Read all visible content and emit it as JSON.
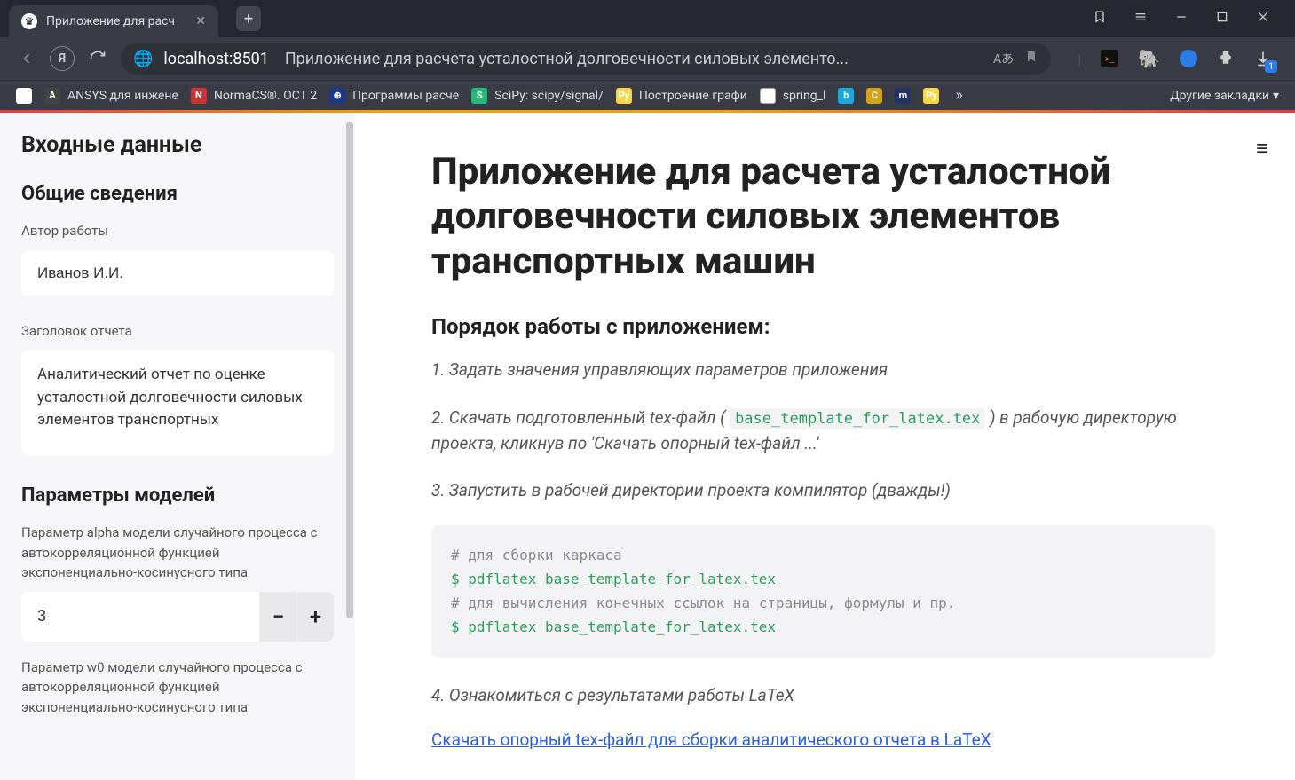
{
  "browser": {
    "tab_title": "Приложение для расч",
    "url_host": "localhost:8501",
    "page_title_truncated": "Приложение для расчета усталостной долговечности силовых элементо...",
    "bookmarks": [
      {
        "label": "ANSYS для инжене"
      },
      {
        "label": "NormaCS®. ОСТ 2"
      },
      {
        "label": "Программы расче"
      },
      {
        "label": "SciPy: scipy/signal/"
      },
      {
        "label": "Построение графи"
      },
      {
        "label": "spring_l"
      }
    ],
    "other_bookmarks_label": "Другие закладки"
  },
  "sidebar": {
    "title": "Входные данные",
    "section_general": "Общие сведения",
    "author_label": "Автор работы",
    "author_value": "Иванов И.И.",
    "report_title_label": "Заголовок отчета",
    "report_title_value": "Аналитический отчет по оценке усталостной долговечности силовых элементов транспортных",
    "section_models": "Параметры моделей",
    "alpha_label": "Параметр alpha модели случайного процесса с автокорреляционной функцией экспоненциально-косинусного типа",
    "alpha_value": "3",
    "w0_label": "Параметр w0 модели случайного процесса с автокорреляционной функцией экспоненциально-косинусного типа"
  },
  "main": {
    "title": "Приложение для расчета усталостной долговечности силовых элементов транспортных машин",
    "guide_heading": "Порядок работы с приложением:",
    "step1": "1. Задать значения управляющих параметров приложения",
    "step2_a": "2. Скачать подготовленный tex-файл ( ",
    "step2_code": "base_template_for_latex.tex",
    "step2_b": " ) в рабочую директорую проекта, кликнув по 'Скачать опорный tex-файл ...'",
    "step3": "3. Запустить в рабочей директории проекта компилятор (дважды!)",
    "code_comment1": "# для сборки каркаса",
    "code_line1": "$ pdflatex base_template_for_latex.tex",
    "code_comment2": "# для вычисления конечных ссылок на страницы, формулы и пр.",
    "code_line2": "$ pdflatex base_template_for_latex.tex",
    "step4": "4. Ознакомиться с результатами работы LaTeX",
    "download_link": "Скачать опорный tex-файл для сборки аналитического отчета в LaTeX"
  }
}
